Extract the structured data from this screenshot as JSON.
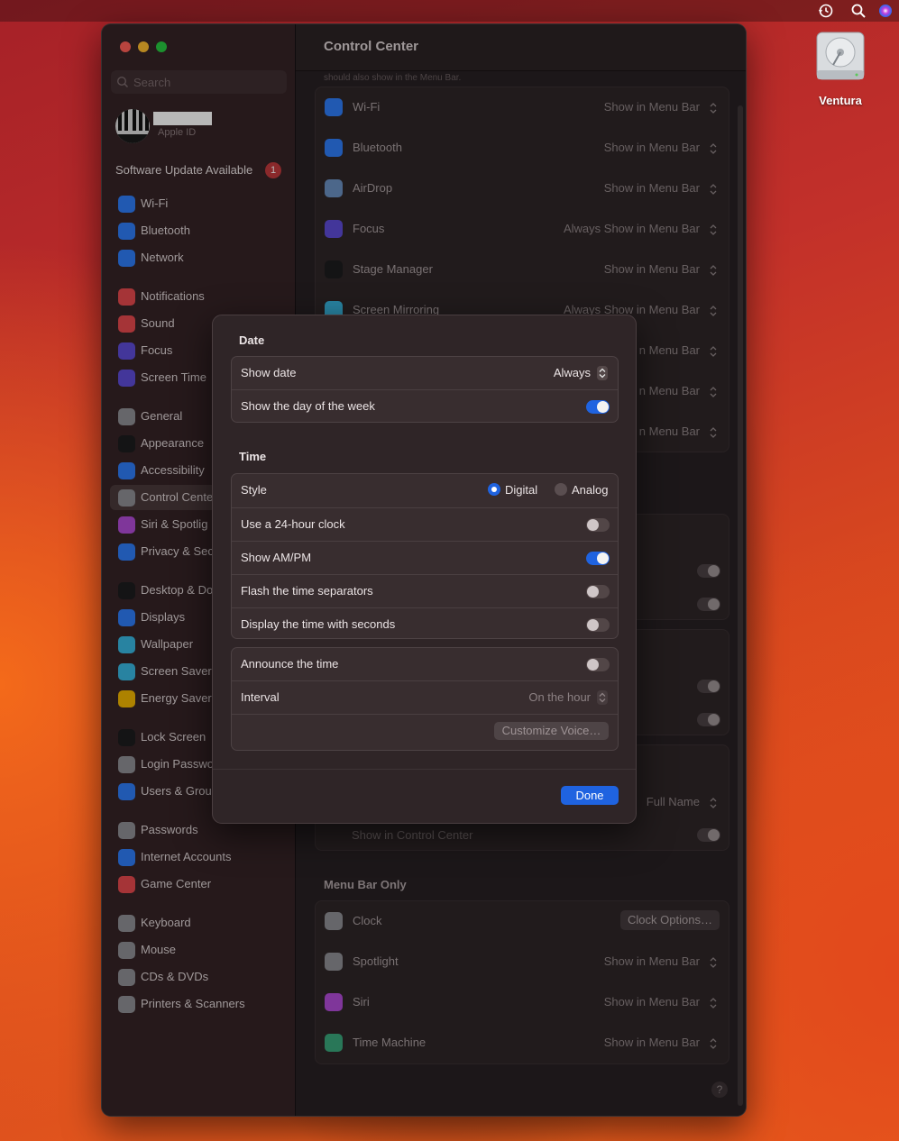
{
  "desktop": {
    "disk_label": "Ventura"
  },
  "sidebar": {
    "search_placeholder": "Search",
    "account_label": "Apple ID",
    "update_text": "Software Update Available",
    "update_badge": "1",
    "items": [
      {
        "label": "Wi-Fi",
        "color": "#2e7cf6"
      },
      {
        "label": "Bluetooth",
        "color": "#2e7cf6"
      },
      {
        "label": "Network",
        "color": "#2e7cf6"
      },
      {
        "label": "Notifications",
        "color": "#e5484d"
      },
      {
        "label": "Sound",
        "color": "#e5484d"
      },
      {
        "label": "Focus",
        "color": "#5e4bd6"
      },
      {
        "label": "Screen Time",
        "color": "#5e4bd6"
      },
      {
        "label": "General",
        "color": "#8e8e93"
      },
      {
        "label": "Appearance",
        "color": "#1c1c1e"
      },
      {
        "label": "Accessibility",
        "color": "#2e7cf6"
      },
      {
        "label": "Control Cente",
        "color": "#8e8e93"
      },
      {
        "label": "Siri & Spotlig",
        "color": "#b04bd6"
      },
      {
        "label": "Privacy & Sec",
        "color": "#2e7cf6"
      },
      {
        "label": "Desktop & Do",
        "color": "#1c1c1e"
      },
      {
        "label": "Displays",
        "color": "#2e7cf6"
      },
      {
        "label": "Wallpaper",
        "color": "#38b6e0"
      },
      {
        "label": "Screen Saver",
        "color": "#38b6e0"
      },
      {
        "label": "Energy Saver",
        "color": "#f0b400"
      },
      {
        "label": "Lock Screen",
        "color": "#1c1c1e"
      },
      {
        "label": "Login Passwo",
        "color": "#8e8e93"
      },
      {
        "label": "Users & Grou",
        "color": "#2e7cf6"
      },
      {
        "label": "Passwords",
        "color": "#8e8e93"
      },
      {
        "label": "Internet Accounts",
        "color": "#2e7cf6"
      },
      {
        "label": "Game Center",
        "color": "#e5484d"
      },
      {
        "label": "Keyboard",
        "color": "#8e8e93"
      },
      {
        "label": "Mouse",
        "color": "#8e8e93"
      },
      {
        "label": "CDs & DVDs",
        "color": "#8e8e93"
      },
      {
        "label": "Printers & Scanners",
        "color": "#8e8e93"
      }
    ]
  },
  "content": {
    "title": "Control Center",
    "cut_text": "should also show in the Menu Bar.",
    "modules": [
      {
        "label": "Wi-Fi",
        "value": "Show in Menu Bar",
        "color": "#2e7cf6"
      },
      {
        "label": "Bluetooth",
        "value": "Show in Menu Bar",
        "color": "#2e7cf6"
      },
      {
        "label": "AirDrop",
        "value": "Show in Menu Bar",
        "color": "#6a8fc0"
      },
      {
        "label": "Focus",
        "value": "Always Show in Menu Bar",
        "color": "#5e4bd6"
      },
      {
        "label": "Stage Manager",
        "value": "Show in Menu Bar",
        "color": "#1c1c1e"
      },
      {
        "label": "Screen Mirroring",
        "value": "Always Show in Menu Bar",
        "color": "#38b6e0"
      },
      {
        "label": "",
        "value": "n Menu Bar",
        "color": "#2e2628"
      },
      {
        "label": "",
        "value": "n Menu Bar",
        "color": "#2e2628"
      },
      {
        "label": "",
        "value": "n Menu Bar",
        "color": "#2e2628"
      }
    ],
    "user_switch_value": "Full Name",
    "show_in_cc_label": "Show in Control Center",
    "menu_bar_only_title": "Menu Bar Only",
    "menu_bar_only": [
      {
        "label": "Clock",
        "value": "Clock Options…",
        "color": "#8e8e93"
      },
      {
        "label": "Spotlight",
        "value": "Show in Menu Bar",
        "color": "#8e8e93"
      },
      {
        "label": "Siri",
        "value": "Show in Menu Bar",
        "color": "#b04bd6"
      },
      {
        "label": "Time Machine",
        "value": "Show in Menu Bar",
        "color": "#3aa57a"
      }
    ],
    "help": "?"
  },
  "dialog": {
    "date_title": "Date",
    "show_date_label": "Show date",
    "show_date_value": "Always",
    "day_of_week_label": "Show the day of the week",
    "day_of_week_on": true,
    "time_title": "Time",
    "style_label": "Style",
    "style_digital": "Digital",
    "style_analog": "Analog",
    "style_selected": "Digital",
    "clock24_label": "Use a 24-hour clock",
    "clock24_on": false,
    "ampm_label": "Show AM/PM",
    "ampm_on": true,
    "flash_label": "Flash the time separators",
    "flash_on": false,
    "seconds_label": "Display the time with seconds",
    "seconds_on": false,
    "announce_label": "Announce the time",
    "announce_on": false,
    "interval_label": "Interval",
    "interval_value": "On the hour",
    "customize_voice": "Customize Voice…",
    "done": "Done"
  },
  "colors": {
    "accent": "#1f63e0",
    "badge": "#c0393c"
  }
}
